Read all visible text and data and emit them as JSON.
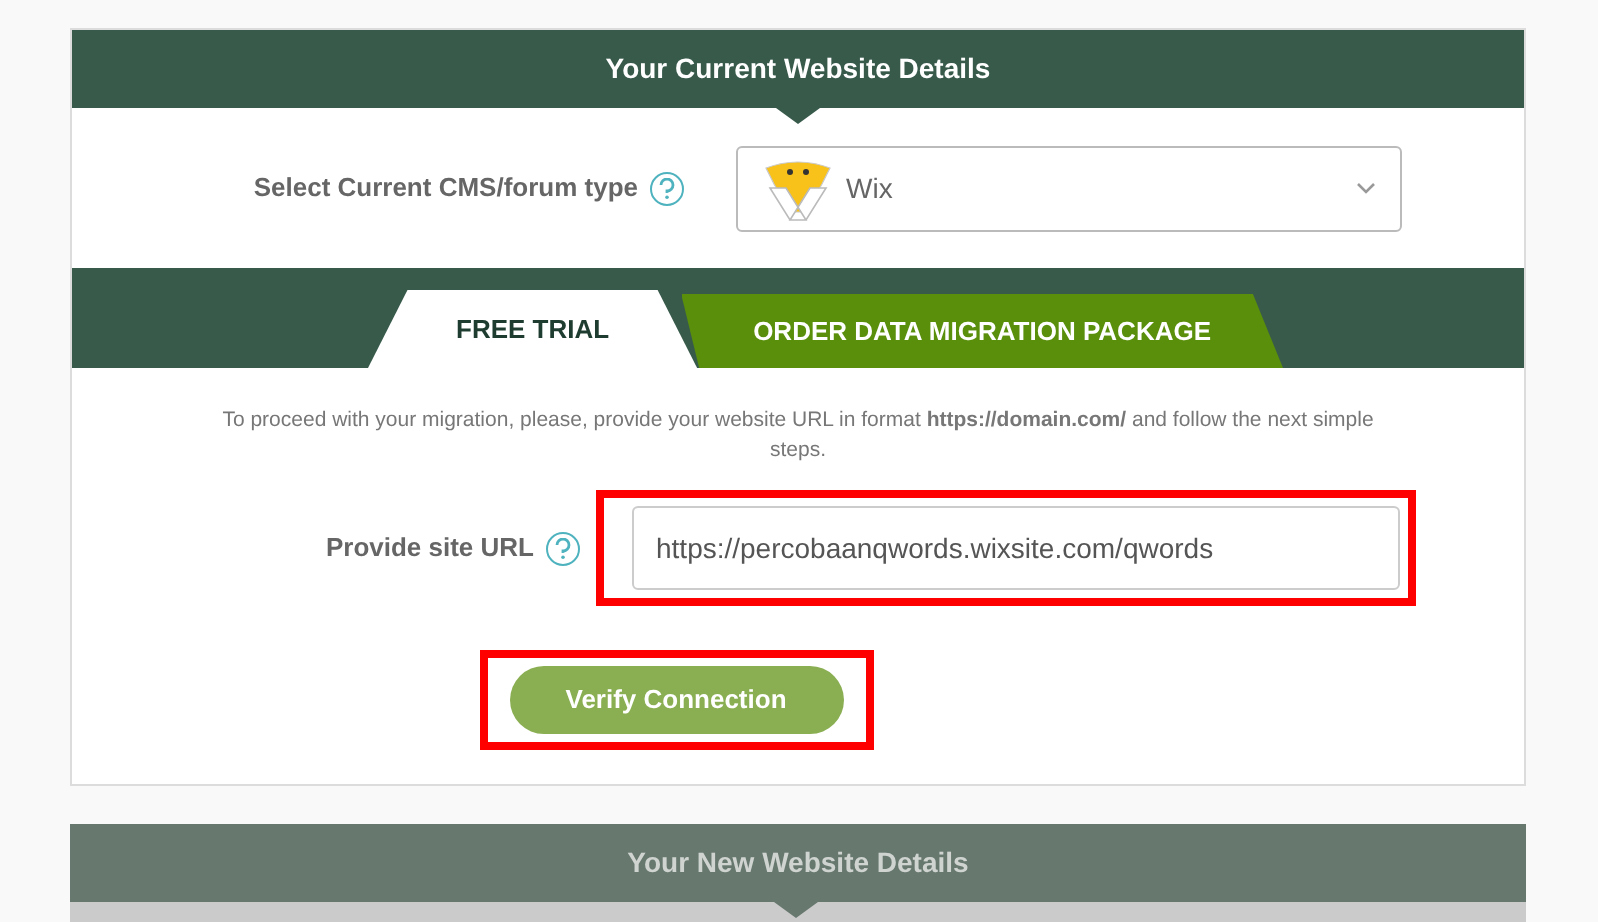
{
  "current_section": {
    "title": "Your Current Website Details",
    "cms_label": "Select Current CMS/forum type",
    "cms_value": "Wix"
  },
  "tabs": [
    {
      "label": "FREE TRIAL",
      "selected": true
    },
    {
      "label": "ORDER DATA MIGRATION PACKAGE",
      "selected": false
    }
  ],
  "note": "To proceed with your migration, please, provide your website URL in format **https://domain.com/** and follow the next simple steps.",
  "url_label": "Provide site URL",
  "url_value": "https://percobaanqwords.wixsite.com/qwords",
  "verify_button": "Verify Connection",
  "new_section": {
    "title": "Your New Website Details"
  }
}
